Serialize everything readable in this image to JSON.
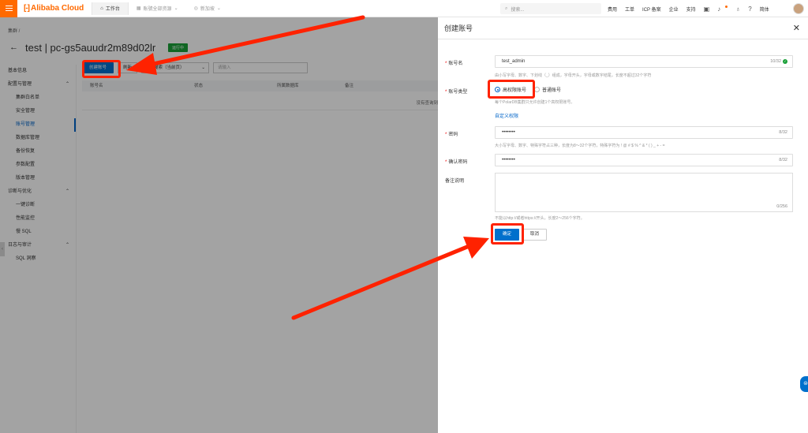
{
  "topbar": {
    "logo": "Alibaba Cloud",
    "nav": [
      {
        "label": "工作台",
        "icon": "home-icon"
      },
      {
        "label": "账號全部资源",
        "icon": "resource-icon"
      },
      {
        "label": "新加坡",
        "icon": "globe-icon"
      }
    ],
    "search_placeholder": "搜索...",
    "links": [
      "费用",
      "工单",
      "ICP 备案",
      "企业",
      "支持"
    ],
    "user_label": "简体"
  },
  "console": {
    "breadcrumb": "集群  /",
    "title": "test | pc-gs5auudr2m89d02lr",
    "status": "运行中",
    "sidebar": [
      {
        "type": "group",
        "label": "基本信息"
      },
      {
        "type": "group",
        "label": "配置与管理"
      },
      {
        "type": "item",
        "label": "集群白名单"
      },
      {
        "type": "item",
        "label": "安全管理"
      },
      {
        "type": "item",
        "label": "账号管理",
        "active": true
      },
      {
        "type": "item",
        "label": "数据库管理"
      },
      {
        "type": "item",
        "label": "备份恢复"
      },
      {
        "type": "item",
        "label": "参数配置"
      },
      {
        "type": "item",
        "label": "版本管理"
      },
      {
        "type": "group",
        "label": "诊断与优化"
      },
      {
        "type": "item",
        "label": "一键诊断"
      },
      {
        "type": "item",
        "label": "性能监控"
      },
      {
        "type": "item",
        "label": "慢 SQL"
      },
      {
        "type": "group",
        "label": "日志与审计"
      },
      {
        "type": "item",
        "label": "SQL 洞察"
      }
    ],
    "toolbar": {
      "create_account": "创建账号",
      "refresh": "刷新",
      "filter_select": "模糊搜索（当前页）",
      "search_placeholder": "请输入"
    },
    "table": {
      "columns": [
        "账号名",
        "状态",
        "所属数据库",
        "备注"
      ],
      "empty": "没有查询到"
    }
  },
  "drawer": {
    "title": "创建账号",
    "account_name": {
      "label": "账号名",
      "value": "test_admin",
      "counter": "10/32",
      "hint": "由小写字母、数字、下划线（_）组成，字母开头，字母或数字结尾，长度不超过32个字符"
    },
    "account_type": {
      "label": "账号类型",
      "options": [
        {
          "label": "高权限账号",
          "checked": true
        },
        {
          "label": "普通账号",
          "checked": false
        }
      ],
      "hint": "每个PolarDB集群只允许创建1个高权限账号。",
      "link": "自定义权限"
    },
    "password": {
      "label": "密码",
      "value": "••••••••",
      "counter": "8/32",
      "hint": "大小写字母、数字、特殊字符占三种，长度为8～32个字符，特殊字符为 ! @ # $ % ^ & * ( ) _ + - ="
    },
    "confirm_password": {
      "label": "确认密码",
      "value": "••••••••",
      "counter": "8/32"
    },
    "remark": {
      "label": "备注说明",
      "counter": "0/256",
      "hint": "不能以http://或者https://开头，长度2～256个字符。"
    },
    "buttons": {
      "ok": "确定",
      "cancel": "取消"
    }
  },
  "annotations": {
    "highlight_color": "#ff2200"
  }
}
